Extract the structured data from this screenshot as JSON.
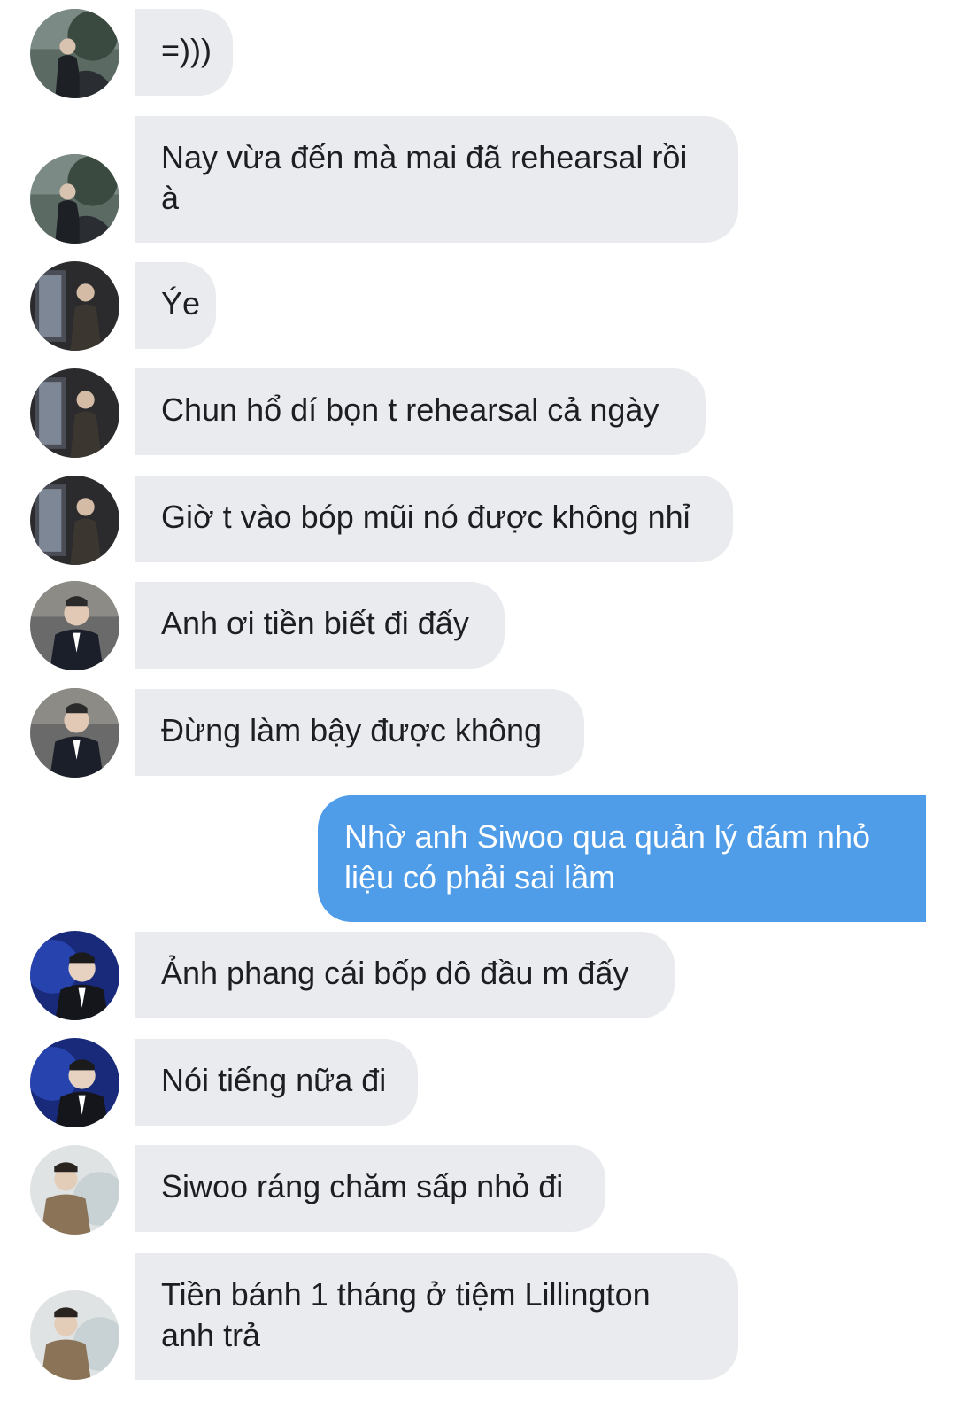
{
  "messages": [
    {
      "text": "=)))",
      "sender": "them",
      "avatar": "avatar-a"
    },
    {
      "text": "Nay vừa đến mà mai đã rehearsal rồi à",
      "sender": "them",
      "avatar": "avatar-a"
    },
    {
      "text": "Ýe",
      "sender": "them",
      "avatar": "avatar-b"
    },
    {
      "text": "Chun hổ dí bọn t rehearsal cả ngày",
      "sender": "them",
      "avatar": "avatar-b"
    },
    {
      "text": "Giờ t vào bóp mũi nó được không nhỉ",
      "sender": "them",
      "avatar": "avatar-b"
    },
    {
      "text": "Anh ơi tiền biết đi đấy",
      "sender": "them",
      "avatar": "avatar-c"
    },
    {
      "text": "Đừng làm bậy được không",
      "sender": "them",
      "avatar": "avatar-c"
    },
    {
      "text": "Nhờ anh Siwoo qua quản lý đám nhỏ liệu có phải sai lầm",
      "sender": "me"
    },
    {
      "text": "Ảnh phang cái bốp dô đầu m đấy",
      "sender": "them",
      "avatar": "avatar-d"
    },
    {
      "text": "Nói tiếng nữa đi",
      "sender": "them",
      "avatar": "avatar-d"
    },
    {
      "text": "Siwoo ráng chăm sấp nhỏ đi",
      "sender": "them",
      "avatar": "avatar-e"
    },
    {
      "text": "Tiền bánh 1 tháng ở tiệm Lillington anh trả",
      "sender": "them",
      "avatar": "avatar-e"
    }
  ],
  "colors": {
    "incoming_bubble": "#e9ebee",
    "outgoing_bubble": "#4f9ce8",
    "incoming_text": "#1c1e21",
    "outgoing_text": "#ffffff"
  }
}
